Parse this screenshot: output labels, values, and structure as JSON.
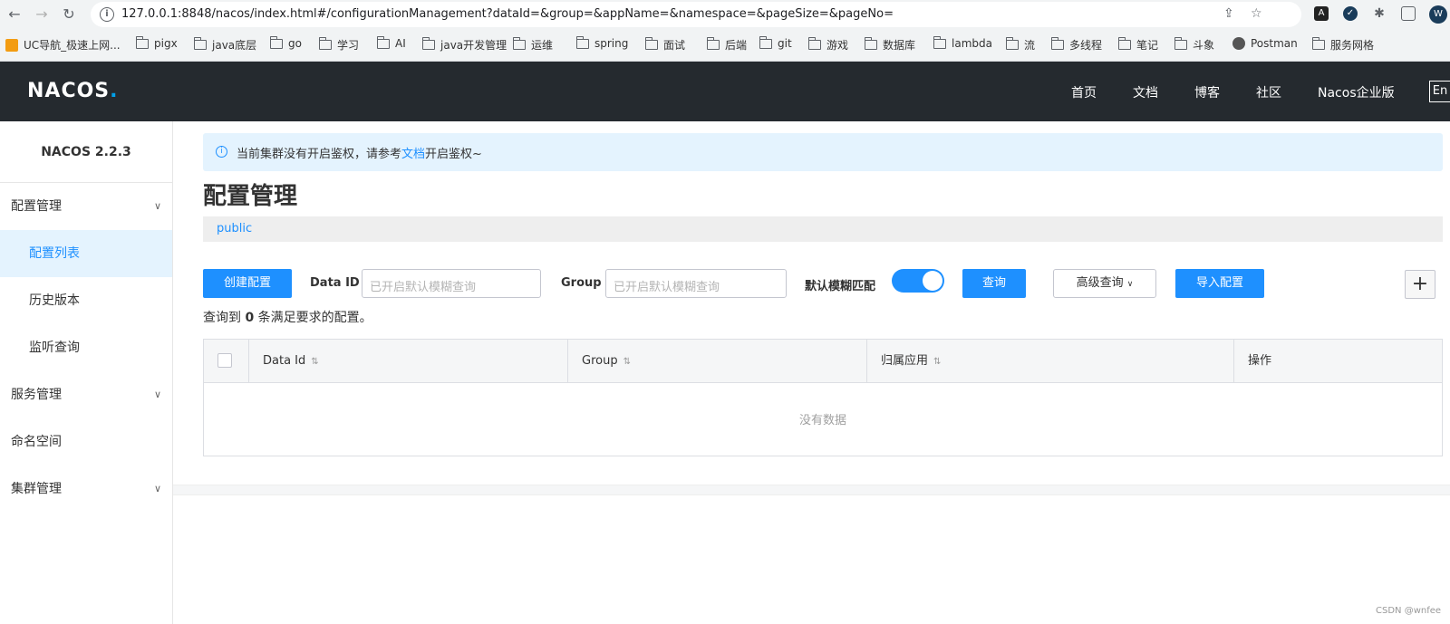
{
  "browser": {
    "url": "127.0.0.1:8848/nacos/index.html#/configurationManagement?dataId=&group=&appName=&namespace=&pageSize=&pageNo=",
    "avatar_letter": "W",
    "bookmarks": [
      "UC导航_极速上网...",
      "pigx",
      "java底层",
      "go",
      "学习",
      "AI",
      "java开发管理",
      "运维",
      "spring",
      "面试",
      "后端",
      "git",
      "游戏",
      "数据库",
      "lambda",
      "流",
      "多线程",
      "笔记",
      "斗象",
      "Postman",
      "服务网格"
    ]
  },
  "header": {
    "logo": "NACOS.",
    "nav": [
      "首页",
      "文档",
      "博客",
      "社区",
      "Nacos企业版"
    ],
    "lang": "En"
  },
  "sidebar": {
    "version": "NACOS 2.2.3",
    "items": [
      {
        "label": "配置管理",
        "level": 1,
        "expandable": true
      },
      {
        "label": "配置列表",
        "level": 2,
        "active": true
      },
      {
        "label": "历史版本",
        "level": 2
      },
      {
        "label": "监听查询",
        "level": 2
      },
      {
        "label": "服务管理",
        "level": 1,
        "expandable": true
      },
      {
        "label": "命名空间",
        "level": 1
      },
      {
        "label": "集群管理",
        "level": 1,
        "expandable": true
      }
    ]
  },
  "main": {
    "alert_text": "当前集群没有开启鉴权，请参考",
    "alert_link": "文档",
    "alert_suffix": "开启鉴权~",
    "title": "配置管理",
    "namespace": "public",
    "create_btn": "创建配置",
    "data_id_label": "Data ID",
    "data_id_placeholder": "已开启默认模糊查询",
    "group_label": "Group",
    "group_placeholder": "已开启默认模糊查询",
    "fuzzy_label": "默认模糊匹配",
    "fuzzy_on": true,
    "query_btn": "查询",
    "advanced_btn": "高级查询",
    "import_btn": "导入配置",
    "add_icon": "+",
    "count_prefix": "查询到",
    "count": "0",
    "count_suffix": "条满足要求的配置。",
    "columns": [
      "Data Id",
      "Group",
      "归属应用",
      "操作"
    ],
    "empty_text": "没有数据"
  },
  "watermark": "CSDN @wnfee",
  "colors": {
    "primary": "#1e90ff",
    "topbar": "#252a2f",
    "active_bg": "#e4f3fe"
  }
}
